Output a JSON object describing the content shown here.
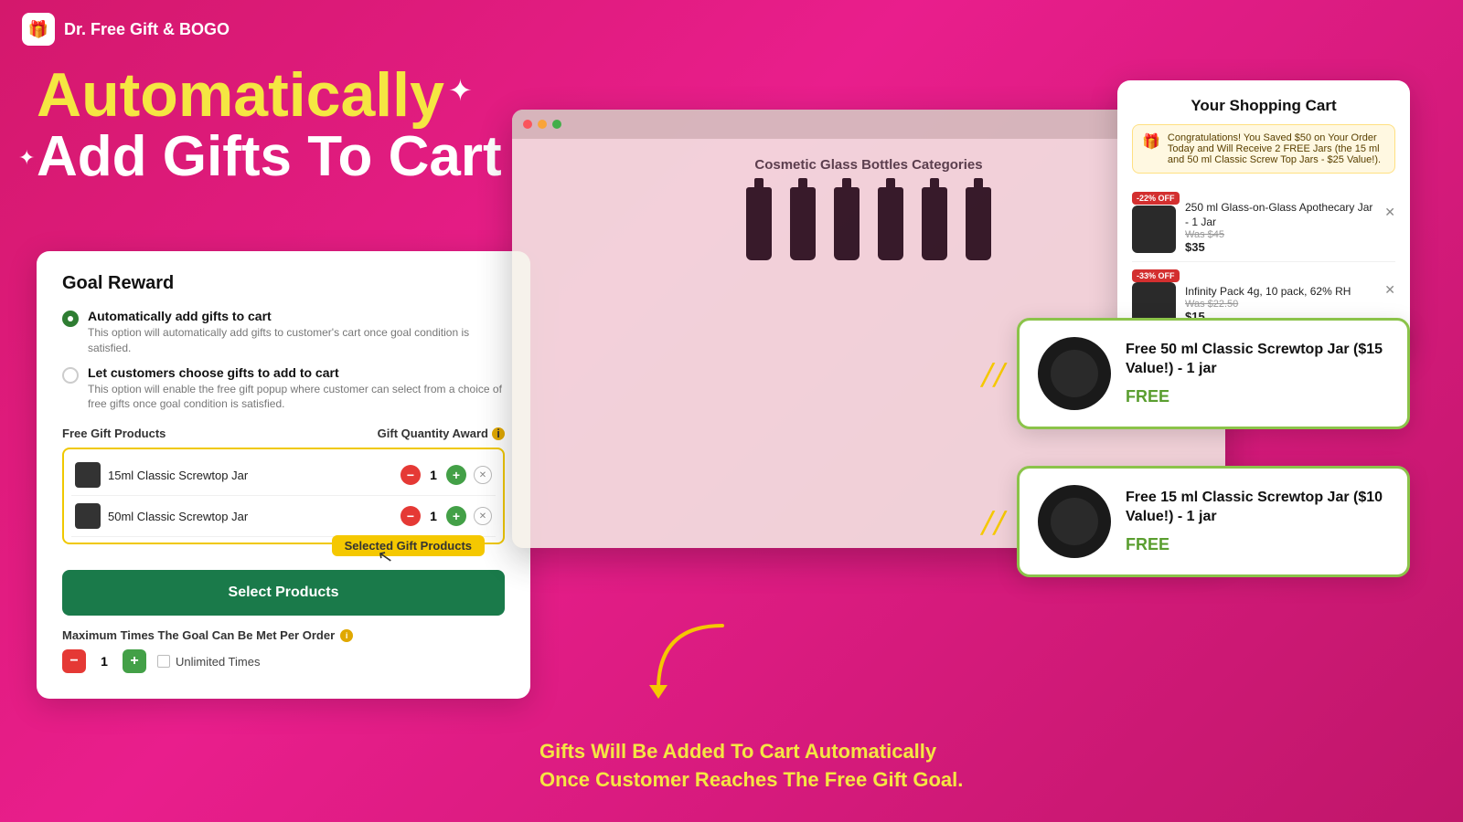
{
  "app": {
    "title": "Dr. Free Gift & BOGO",
    "logo": "🎁"
  },
  "hero": {
    "line1": "Automatically",
    "line2": "Add Gifts To Cart"
  },
  "goal_card": {
    "title": "Goal Reward",
    "option1": {
      "label": "Automatically add gifts to cart",
      "desc": "This option will automatically add gifts to customer's cart once goal condition is satisfied.",
      "selected": true
    },
    "option2": {
      "label": "Let customers choose gifts to add to cart",
      "desc": "This option will enable the free gift popup where customer can select from a choice of free gifts once goal condition is satisfied.",
      "selected": false
    },
    "products_label": "Free Gift Products",
    "qty_label": "Gift Quantity Award",
    "products": [
      {
        "name": "15ml Classic Screwtop Jar",
        "qty": 1
      },
      {
        "name": "50ml Classic Screwtop Jar",
        "qty": 1
      }
    ],
    "selected_badge": "Selected Gift Products",
    "select_button": "Select Products",
    "max_label": "Maximum Times The Goal Can Be Met Per Order",
    "max_qty": 1,
    "unlimited_label": "Unlimited Times"
  },
  "browser": {
    "title": "Cosmetic Glass Bottles Categories"
  },
  "cart": {
    "title": "Your Shopping Cart",
    "congrats": "Congratulations! You Saved $50 on Your Order Today and Will Receive 2 FREE Jars (the 15 ml and 50 ml Classic Screw Top Jars - $25 Value!).",
    "items": [
      {
        "badge": "-22% OFF",
        "name": "250 ml Glass-on-Glass Apothecary Jar - 1 Jar",
        "was": "Was $45",
        "price": "$35"
      },
      {
        "badge": "-33% OFF",
        "name": "Infinity Pack 4g, 10 pack, 62% RH",
        "was": "Was $22.50",
        "price": "$15"
      }
    ]
  },
  "gift_cards": [
    {
      "name": "Free 50 ml Classic Screwtop Jar ($15 Value!) - 1 jar",
      "free_label": "FREE"
    },
    {
      "name": "Free 15 ml Classic Screwtop Jar ($10 Value!) - 1 jar",
      "free_label": "FREE"
    }
  ],
  "bottom_text": "Gifts Will Be Added To Cart Automatically\nOnce Customer Reaches The Free Gift Goal.",
  "colors": {
    "bg_gradient_start": "#d4186c",
    "bg_gradient_end": "#c0166a",
    "accent_yellow": "#f5e642",
    "accent_green": "#1a7a4a",
    "brand_green": "#5a9e2f",
    "card_border": "#8bc34a"
  }
}
